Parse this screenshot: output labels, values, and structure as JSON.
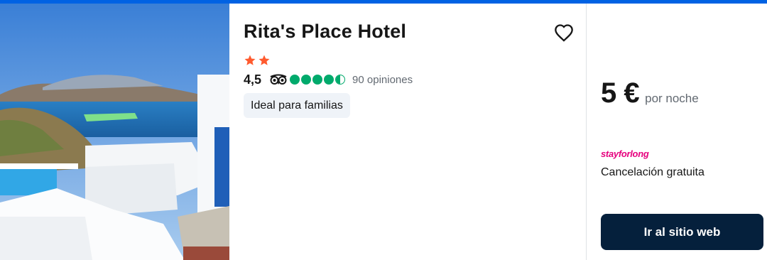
{
  "hotel": {
    "name": "Rita's Place Hotel",
    "stars": 2,
    "rating": "4,5",
    "bubble_rating": 4.5,
    "reviews": "90 opiniones",
    "tag": "Ideal para familias"
  },
  "offer": {
    "price": "5 €",
    "per_night": "por noche",
    "provider": "stayforlong",
    "cancellation": "Cancelación gratuita",
    "cta_label": "Ir al sitio web"
  },
  "colors": {
    "accent_bar": "#0062e3",
    "star": "#ff5a2e",
    "tripadvisor_green": "#00aa6c",
    "provider_pink": "#e6007e",
    "cta_background": "#05203c"
  },
  "icons": {
    "favorite": "heart-outline-icon",
    "star": "star-icon",
    "tripadvisor": "tripadvisor-owl-icon"
  }
}
